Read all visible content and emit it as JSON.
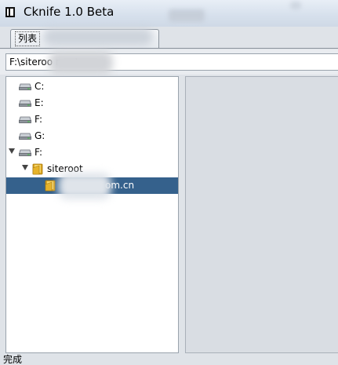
{
  "window": {
    "title": "Cknife 1.0 Beta"
  },
  "tabs": [
    {
      "label": "列表"
    }
  ],
  "pathbar": {
    "value": "F:\\siteroo                     n.cn\\"
  },
  "tree": {
    "items": [
      {
        "label": "C:",
        "icon": "drive-icon"
      },
      {
        "label": "E:",
        "icon": "drive-icon"
      },
      {
        "label": "F:",
        "icon": "drive-icon"
      },
      {
        "label": "G:",
        "icon": "drive-icon"
      },
      {
        "label": "F:",
        "icon": "drive-icon",
        "expanded": true
      },
      {
        "label": "siteroot",
        "icon": "folder-icon",
        "expanded": true
      },
      {
        "label": "om.cn",
        "icon": "folder-icon",
        "selected": true
      }
    ]
  },
  "status": {
    "text": "完成"
  },
  "colors": {
    "selection": "#35618c",
    "titlebar": "#d6e0ec"
  }
}
